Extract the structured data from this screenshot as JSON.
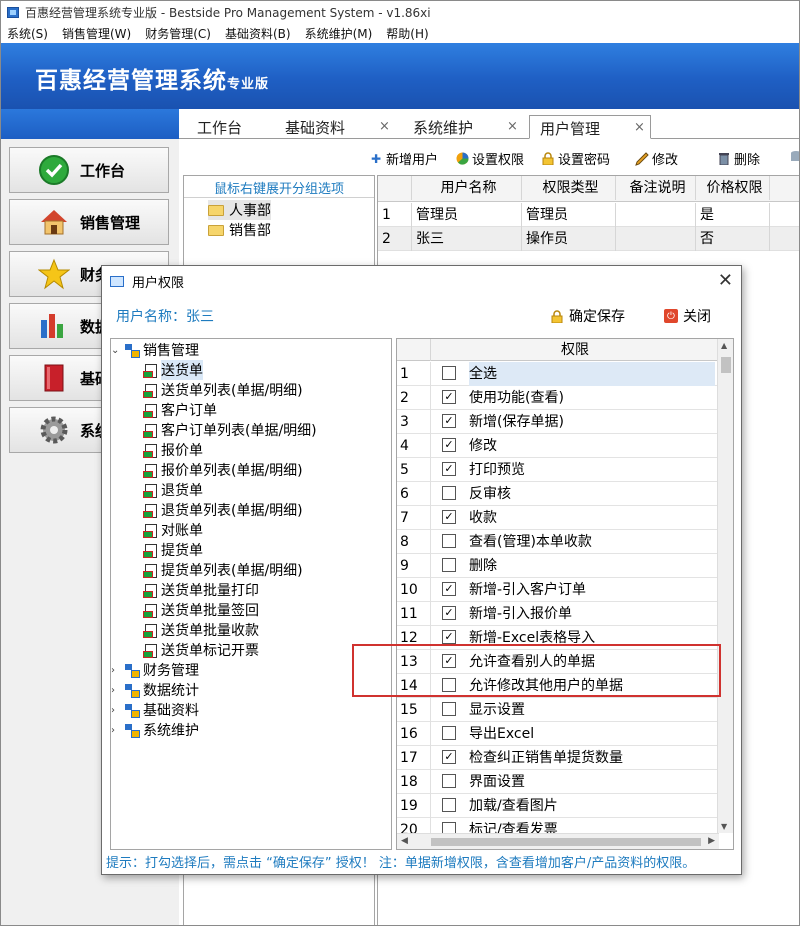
{
  "window": {
    "title": "百惠经营管理系统专业版 - Bestside Pro Management System - v1.86xi"
  },
  "menu": [
    "系统(S)",
    "销售管理(W)",
    "财务管理(C)",
    "基础资料(B)",
    "系统维护(M)",
    "帮助(H)"
  ],
  "banner": {
    "title": "百惠经营管理系统",
    "edition": "专业版"
  },
  "leftnav": [
    {
      "label": "工作台",
      "icon": "check-circle-icon"
    },
    {
      "label": "销售管理",
      "icon": "house-icon"
    },
    {
      "label": "财务",
      "icon": "star-icon"
    },
    {
      "label": "数据",
      "icon": "bar-chart-icon"
    },
    {
      "label": "基础",
      "icon": "book-icon"
    },
    {
      "label": "系统",
      "icon": "gear-icon"
    }
  ],
  "tabs": [
    {
      "label": "工作台"
    },
    {
      "label": "基础资料"
    },
    {
      "label": "系统维护"
    },
    {
      "label": "用户管理",
      "active": true
    }
  ],
  "toolbar": {
    "add_user": "新增用户",
    "set_perm": "设置权限",
    "set_pwd": "设置密码",
    "edit": "修改",
    "delete": "删除"
  },
  "groups": {
    "hint": "鼠标右键展开分组选项",
    "items": [
      "人事部",
      "销售部"
    ]
  },
  "users": {
    "columns": [
      "用户名称",
      "权限类型",
      "备注说明",
      "价格权限"
    ],
    "rows": [
      {
        "no": "1",
        "name": "管理员",
        "type": "管理员",
        "note": "",
        "price": "是"
      },
      {
        "no": "2",
        "name": "张三",
        "type": "操作员",
        "note": "",
        "price": "否"
      }
    ]
  },
  "dialog": {
    "title": "用户权限",
    "user_label": "用户名称：张三",
    "save": "确定保存",
    "close": "关闭",
    "tree": {
      "root1": "销售管理",
      "children": [
        "送货单",
        "送货单列表(单据/明细)",
        "客户订单",
        "客户订单列表(单据/明细)",
        "报价单",
        "报价单列表(单据/明细)",
        "退货单",
        "退货单列表(单据/明细)",
        "对账单",
        "提货单",
        "提货单列表(单据/明细)",
        "送货单批量打印",
        "送货单批量签回",
        "送货单批量收款",
        "送货单标记开票"
      ],
      "others": [
        "财务管理",
        "数据统计",
        "基础资料",
        "系统维护"
      ]
    },
    "grid": {
      "header": "权限",
      "rows": [
        {
          "no": "1",
          "label": "全选",
          "checked": false
        },
        {
          "no": "2",
          "label": "使用功能(查看)",
          "checked": true
        },
        {
          "no": "3",
          "label": "新增(保存单据)",
          "checked": true
        },
        {
          "no": "4",
          "label": "修改",
          "checked": true
        },
        {
          "no": "5",
          "label": "打印预览",
          "checked": true
        },
        {
          "no": "6",
          "label": "反审核",
          "checked": false
        },
        {
          "no": "7",
          "label": "收款",
          "checked": true
        },
        {
          "no": "8",
          "label": "查看(管理)本单收款",
          "checked": false
        },
        {
          "no": "9",
          "label": "删除",
          "checked": false
        },
        {
          "no": "10",
          "label": "新增-引入客户订单",
          "checked": true
        },
        {
          "no": "11",
          "label": "新增-引入报价单",
          "checked": true
        },
        {
          "no": "12",
          "label": "新增-Excel表格导入",
          "checked": true
        },
        {
          "no": "13",
          "label": "允许查看别人的单据",
          "checked": true
        },
        {
          "no": "14",
          "label": "允许修改其他用户的单据",
          "checked": false
        },
        {
          "no": "15",
          "label": "显示设置",
          "checked": false
        },
        {
          "no": "16",
          "label": "导出Excel",
          "checked": false
        },
        {
          "no": "17",
          "label": "检查纠正销售单提货数量",
          "checked": true
        },
        {
          "no": "18",
          "label": "界面设置",
          "checked": false
        },
        {
          "no": "19",
          "label": "加载/查看图片",
          "checked": false
        },
        {
          "no": "20",
          "label": "标记/查看发票",
          "checked": false
        }
      ]
    },
    "tip": "提示：打勾选择后，需点击 “确定保存” 授权！ 注：单据新增权限，含查看增加客户/产品资料的权限。"
  }
}
